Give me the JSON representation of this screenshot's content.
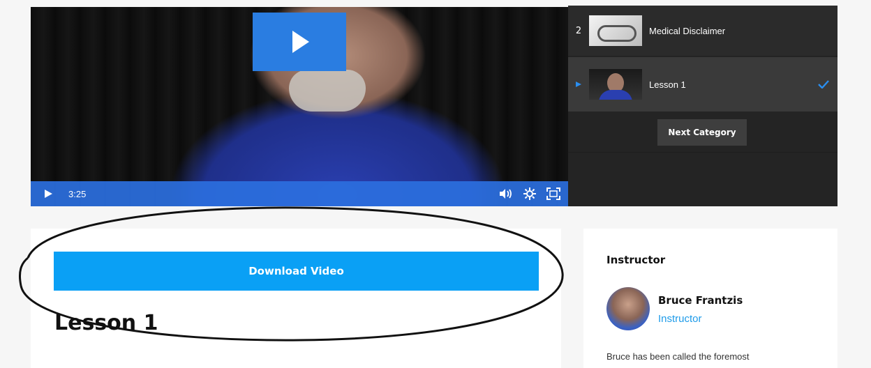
{
  "player": {
    "time": "3:25",
    "icons": {
      "big_play": "play-icon",
      "play": "play-icon",
      "volume": "volume-icon",
      "settings": "gear-icon",
      "fullscreen": "fullscreen-icon"
    },
    "accent_color": "#2b6fde"
  },
  "playlist": {
    "items": [
      {
        "number": "2",
        "title": "Medical Disclaimer"
      },
      {
        "title": "Lesson 1",
        "active": true,
        "completed": true
      }
    ],
    "next_label": "Next Category"
  },
  "main": {
    "download_label": "Download Video",
    "lesson_title": "Lesson 1",
    "button_color": "#0aa0f5"
  },
  "instructor": {
    "heading": "Instructor",
    "name": "Bruce Frantzis",
    "role": "Instructor",
    "bio": "Bruce has been called the foremost"
  }
}
